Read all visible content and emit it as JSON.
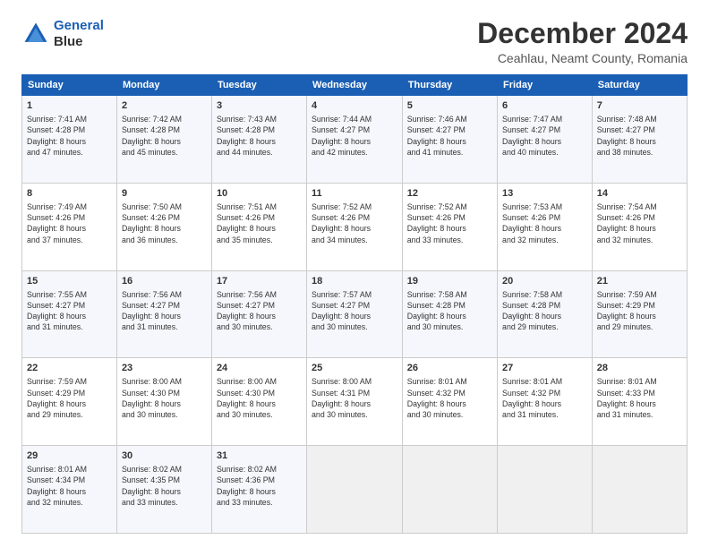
{
  "header": {
    "logo_line1": "General",
    "logo_line2": "Blue",
    "main_title": "December 2024",
    "subtitle": "Ceahlau, Neamt County, Romania"
  },
  "calendar": {
    "days_of_week": [
      "Sunday",
      "Monday",
      "Tuesday",
      "Wednesday",
      "Thursday",
      "Friday",
      "Saturday"
    ],
    "weeks": [
      [
        {
          "day": "1",
          "info": "Sunrise: 7:41 AM\nSunset: 4:28 PM\nDaylight: 8 hours\nand 47 minutes."
        },
        {
          "day": "2",
          "info": "Sunrise: 7:42 AM\nSunset: 4:28 PM\nDaylight: 8 hours\nand 45 minutes."
        },
        {
          "day": "3",
          "info": "Sunrise: 7:43 AM\nSunset: 4:28 PM\nDaylight: 8 hours\nand 44 minutes."
        },
        {
          "day": "4",
          "info": "Sunrise: 7:44 AM\nSunset: 4:27 PM\nDaylight: 8 hours\nand 42 minutes."
        },
        {
          "day": "5",
          "info": "Sunrise: 7:46 AM\nSunset: 4:27 PM\nDaylight: 8 hours\nand 41 minutes."
        },
        {
          "day": "6",
          "info": "Sunrise: 7:47 AM\nSunset: 4:27 PM\nDaylight: 8 hours\nand 40 minutes."
        },
        {
          "day": "7",
          "info": "Sunrise: 7:48 AM\nSunset: 4:27 PM\nDaylight: 8 hours\nand 38 minutes."
        }
      ],
      [
        {
          "day": "8",
          "info": "Sunrise: 7:49 AM\nSunset: 4:26 PM\nDaylight: 8 hours\nand 37 minutes."
        },
        {
          "day": "9",
          "info": "Sunrise: 7:50 AM\nSunset: 4:26 PM\nDaylight: 8 hours\nand 36 minutes."
        },
        {
          "day": "10",
          "info": "Sunrise: 7:51 AM\nSunset: 4:26 PM\nDaylight: 8 hours\nand 35 minutes."
        },
        {
          "day": "11",
          "info": "Sunrise: 7:52 AM\nSunset: 4:26 PM\nDaylight: 8 hours\nand 34 minutes."
        },
        {
          "day": "12",
          "info": "Sunrise: 7:52 AM\nSunset: 4:26 PM\nDaylight: 8 hours\nand 33 minutes."
        },
        {
          "day": "13",
          "info": "Sunrise: 7:53 AM\nSunset: 4:26 PM\nDaylight: 8 hours\nand 32 minutes."
        },
        {
          "day": "14",
          "info": "Sunrise: 7:54 AM\nSunset: 4:26 PM\nDaylight: 8 hours\nand 32 minutes."
        }
      ],
      [
        {
          "day": "15",
          "info": "Sunrise: 7:55 AM\nSunset: 4:27 PM\nDaylight: 8 hours\nand 31 minutes."
        },
        {
          "day": "16",
          "info": "Sunrise: 7:56 AM\nSunset: 4:27 PM\nDaylight: 8 hours\nand 31 minutes."
        },
        {
          "day": "17",
          "info": "Sunrise: 7:56 AM\nSunset: 4:27 PM\nDaylight: 8 hours\nand 30 minutes."
        },
        {
          "day": "18",
          "info": "Sunrise: 7:57 AM\nSunset: 4:27 PM\nDaylight: 8 hours\nand 30 minutes."
        },
        {
          "day": "19",
          "info": "Sunrise: 7:58 AM\nSunset: 4:28 PM\nDaylight: 8 hours\nand 30 minutes."
        },
        {
          "day": "20",
          "info": "Sunrise: 7:58 AM\nSunset: 4:28 PM\nDaylight: 8 hours\nand 29 minutes."
        },
        {
          "day": "21",
          "info": "Sunrise: 7:59 AM\nSunset: 4:29 PM\nDaylight: 8 hours\nand 29 minutes."
        }
      ],
      [
        {
          "day": "22",
          "info": "Sunrise: 7:59 AM\nSunset: 4:29 PM\nDaylight: 8 hours\nand 29 minutes."
        },
        {
          "day": "23",
          "info": "Sunrise: 8:00 AM\nSunset: 4:30 PM\nDaylight: 8 hours\nand 30 minutes."
        },
        {
          "day": "24",
          "info": "Sunrise: 8:00 AM\nSunset: 4:30 PM\nDaylight: 8 hours\nand 30 minutes."
        },
        {
          "day": "25",
          "info": "Sunrise: 8:00 AM\nSunset: 4:31 PM\nDaylight: 8 hours\nand 30 minutes."
        },
        {
          "day": "26",
          "info": "Sunrise: 8:01 AM\nSunset: 4:32 PM\nDaylight: 8 hours\nand 30 minutes."
        },
        {
          "day": "27",
          "info": "Sunrise: 8:01 AM\nSunset: 4:32 PM\nDaylight: 8 hours\nand 31 minutes."
        },
        {
          "day": "28",
          "info": "Sunrise: 8:01 AM\nSunset: 4:33 PM\nDaylight: 8 hours\nand 31 minutes."
        }
      ],
      [
        {
          "day": "29",
          "info": "Sunrise: 8:01 AM\nSunset: 4:34 PM\nDaylight: 8 hours\nand 32 minutes."
        },
        {
          "day": "30",
          "info": "Sunrise: 8:02 AM\nSunset: 4:35 PM\nDaylight: 8 hours\nand 33 minutes."
        },
        {
          "day": "31",
          "info": "Sunrise: 8:02 AM\nSunset: 4:36 PM\nDaylight: 8 hours\nand 33 minutes."
        },
        {
          "day": "",
          "info": ""
        },
        {
          "day": "",
          "info": ""
        },
        {
          "day": "",
          "info": ""
        },
        {
          "day": "",
          "info": ""
        }
      ]
    ]
  }
}
